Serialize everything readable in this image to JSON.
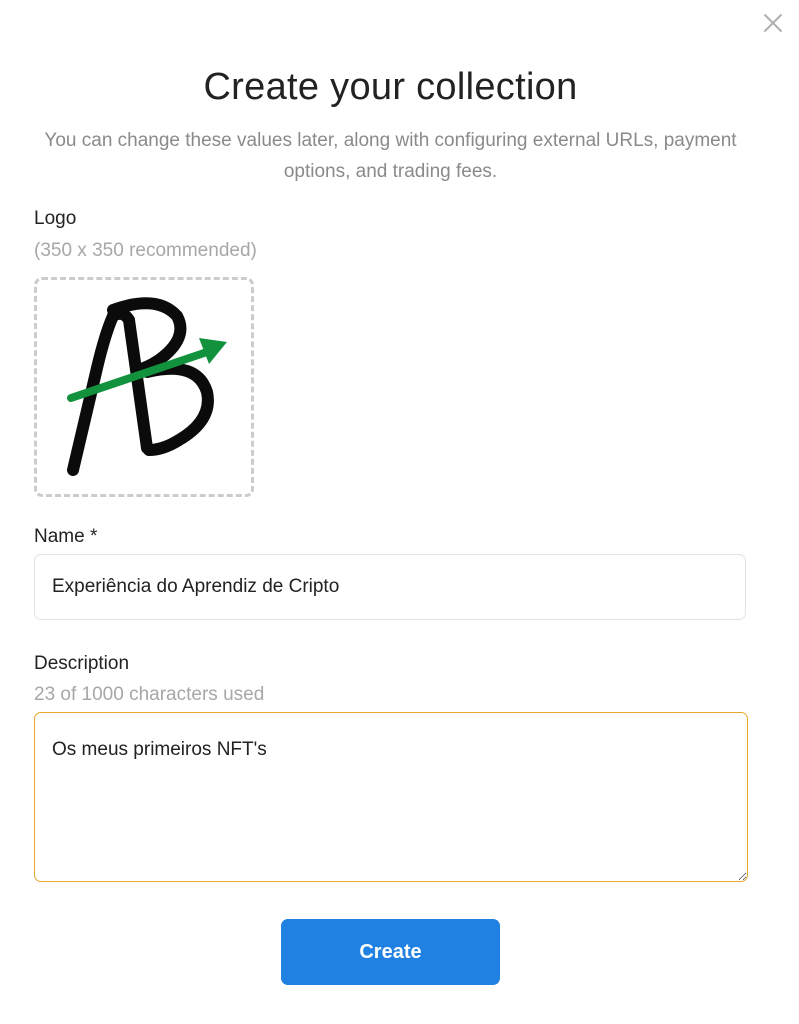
{
  "modal": {
    "close_icon": "close-icon",
    "title": "Create your collection",
    "subtitle": "You can change these values later, along with configuring external URLs, payment options, and trading fees."
  },
  "logo": {
    "label": "Logo",
    "hint": "(350 x 350 recommended)",
    "image_text": "AB",
    "arrow_color": "#12923c",
    "letter_color": "#0b0b0b"
  },
  "name_field": {
    "label": "Name *",
    "value": "Experiência do Aprendiz de Cripto"
  },
  "description_field": {
    "label": "Description",
    "hint": "23 of 1000 characters used",
    "value": "Os meus primeiros NFT's",
    "focus_color": "#e5a82a"
  },
  "create_button": {
    "label": "Create",
    "color": "#2081e2"
  }
}
